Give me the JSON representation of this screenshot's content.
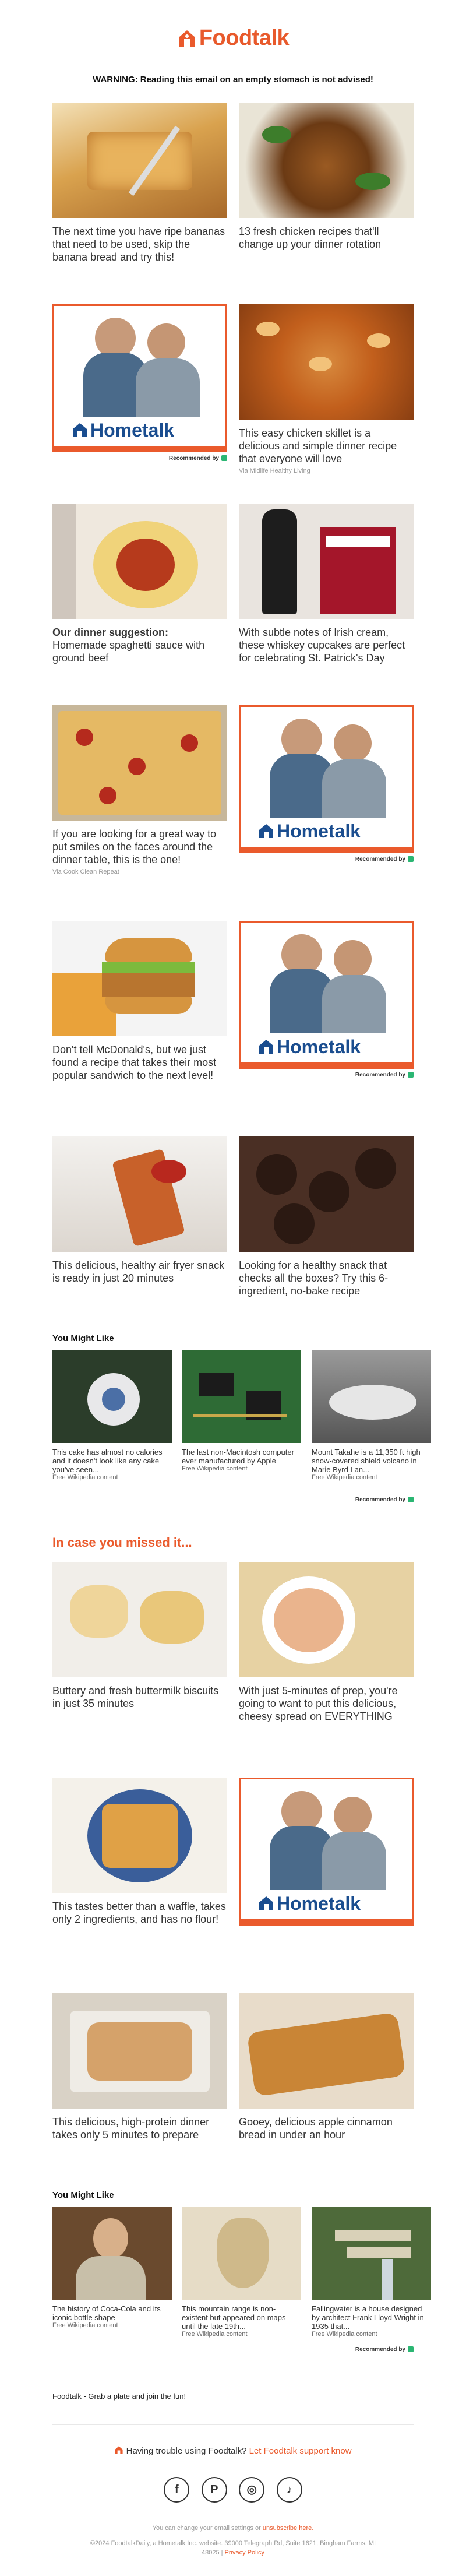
{
  "brand": {
    "name": "Foodtalk",
    "color": "#ea5a2c"
  },
  "warning": "WARNING: Reading this email on an empty stomach is not advised!",
  "cards": [
    {
      "text": "The next time you have ripe bananas that need to be used, skip the banana bread and try this!",
      "source": ""
    },
    {
      "text": "13 fresh chicken recipes that'll change up your dinner rotation",
      "source": ""
    },
    {
      "text": "This easy chicken skillet is a delicious and simple dinner recipe that everyone will love",
      "source": "Via Midlife Healthy Living"
    },
    {
      "bold": "Our dinner suggestion:",
      "text": "Homemade spaghetti sauce with ground beef",
      "source": ""
    },
    {
      "text": "With subtle notes of Irish cream, these whiskey cupcakes are perfect for celebrating St. Patrick's Day",
      "source": ""
    },
    {
      "text": "If you are looking for a great way to put smiles on the faces around the dinner table, this is the one!",
      "source": "Via Cook Clean Repeat"
    },
    {
      "text": "Don't tell McDonald's, but we just found a recipe that takes their most popular sandwich to the next level!",
      "source": ""
    },
    {
      "text": "This delicious, healthy air fryer snack is ready in just 20 minutes",
      "source": ""
    },
    {
      "text": "Looking for a healthy snack that checks all the boxes? Try this 6-ingredient, no-bake recipe",
      "source": ""
    },
    {
      "text": "Buttery and fresh buttermilk biscuits in just 35 minutes",
      "source": ""
    },
    {
      "text": "With just 5-minutes of prep, you're going to want to put this delicious, cheesy spread on EVERYTHING",
      "source": ""
    },
    {
      "text": "This tastes better than a waffle, takes only 2 ingredients, and has no flour!",
      "source": ""
    },
    {
      "text": "This delicious, high-protein dinner takes only 5 minutes to prepare",
      "source": ""
    },
    {
      "text": "Gooey, delicious apple cinnamon bread in under an hour",
      "source": ""
    }
  ],
  "ad": {
    "brand": "Hometalk",
    "recommended": "Recommended by"
  },
  "you_might_like": {
    "heading": "You Might Like",
    "set1": [
      {
        "title": "This cake has almost no calories and it doesn't look like any cake you've seen...",
        "source": "Free Wikipedia content"
      },
      {
        "title": "The last non-Macintosh computer ever manufactured by Apple",
        "source": "Free Wikipedia content"
      },
      {
        "title": "Mount Takahe is a 11,350 ft high snow-covered shield volcano in Marie Byrd Lan...",
        "source": "Free Wikipedia content"
      }
    ],
    "set2": [
      {
        "title": "The history of Coca-Cola and its iconic bottle shape",
        "source": "Free Wikipedia content"
      },
      {
        "title": "This mountain range is non-existent but appeared on maps until the late 19th...",
        "source": "Free Wikipedia content"
      },
      {
        "title": "Fallingwater is a house designed by architect Frank Lloyd Wright in 1935 that...",
        "source": "Free Wikipedia content"
      }
    ]
  },
  "missed_heading": "In case you missed it...",
  "footer": {
    "tagline": "Foodtalk - Grab a plate and join the fun!",
    "support_text": "Having trouble using Foodtalk?",
    "support_link": "Let Foodtalk support know",
    "social": [
      "facebook-icon",
      "pinterest-icon",
      "instagram-icon",
      "tiktok-icon"
    ],
    "settings_text": "You can change your email settings or",
    "unsubscribe": "unsubscribe here.",
    "legal": "©2024 FoodtalkDaily, a Hometalk Inc. website. 39000 Telegraph Rd, Suite 1621, Bingham Farms, MI 48025 |",
    "privacy": "Privacy Policy"
  }
}
